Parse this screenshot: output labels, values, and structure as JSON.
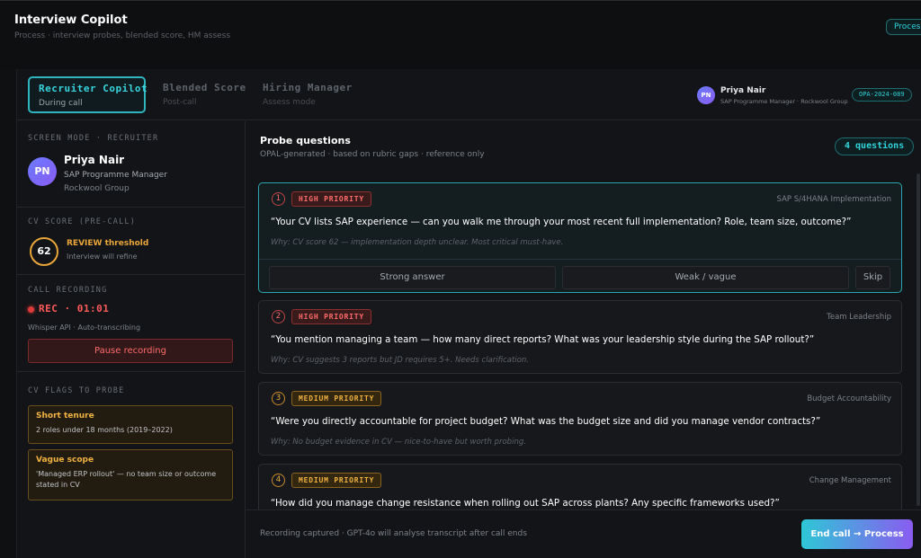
{
  "app": {
    "title": "Interview Copilot",
    "subtitle": "Process · interview probes, blended score, HM assess",
    "process_chip": "Process"
  },
  "tabs": [
    {
      "label": "Recruiter Copilot",
      "sub": "During call",
      "active": true
    },
    {
      "label": "Blended Score",
      "sub": "Post-call",
      "active": false
    },
    {
      "label": "Hiring Manager",
      "sub": "Assess mode",
      "active": false
    }
  ],
  "candidate": {
    "initials": "PN",
    "name": "Priya Nair",
    "role": "SAP Programme Manager",
    "org": "Rockwool Group",
    "role_org": "SAP Programme Manager · Rockwool Group",
    "id": "OPA-2024-089"
  },
  "sidebar": {
    "screen_mode_title": "SCREEN MODE · RECRUITER",
    "cv_score": {
      "title": "CV SCORE (PRE-CALL)",
      "value": "62",
      "status": "REVIEW threshold",
      "note": "Interview will refine",
      "color": "#e8a53a"
    },
    "recording": {
      "title": "CALL RECORDING",
      "status": "REC · 01:01",
      "api": "Whisper API · Auto-transcribing",
      "pause_label": "Pause recording"
    },
    "flags": {
      "title": "CV FLAGS TO PROBE",
      "items": [
        {
          "title": "Short tenure",
          "desc": "2 roles under 18 months (2019–2022)"
        },
        {
          "title": "Vague scope",
          "desc": "'Managed ERP rollout' — no team size or outcome stated in CV"
        }
      ]
    }
  },
  "probes": {
    "title": "Probe questions",
    "subtitle": "OPAL-generated · based on rubric gaps · reference only",
    "count_label": "4 questions",
    "questions": [
      {
        "num": "1",
        "priority": "HIGH PRIORITY",
        "topic": "SAP S/4HANA Implementation",
        "text": "“Your CV lists SAP experience — can you walk me through your most recent full implementation? Role, team size, outcome?”",
        "why": "Why: CV score 62 — implementation depth unclear. Most critical must-have."
      },
      {
        "num": "2",
        "priority": "HIGH PRIORITY",
        "topic": "Team Leadership",
        "text": "“You mention managing a team — how many direct reports? What was your leadership style during the SAP rollout?”",
        "why": "Why: CV suggests 3 reports but JD requires 5+. Needs clarification."
      },
      {
        "num": "3",
        "priority": "MEDIUM PRIORITY",
        "topic": "Budget Accountability",
        "text": "“Were you directly accountable for project budget? What was the budget size and did you manage vendor contracts?”",
        "why": "Why: No budget evidence in CV — nice-to-have but worth probing."
      },
      {
        "num": "4",
        "priority": "MEDIUM PRIORITY",
        "topic": "Change Management",
        "text": "“How did you manage change resistance when rolling out SAP across plants? Any specific frameworks used?”",
        "why": ""
      }
    ],
    "actions": {
      "strong": "Strong answer",
      "weak": "Weak / vague",
      "skip": "Skip"
    }
  },
  "footer": {
    "note": "Recording captured · GPT-4o will analyse transcript after call ends",
    "end_label": "End call → Process"
  },
  "colors": {
    "accent": "#2fd3d8",
    "high": "#ff6b6b",
    "medium": "#f0b240",
    "recording": "#e03b3b"
  }
}
